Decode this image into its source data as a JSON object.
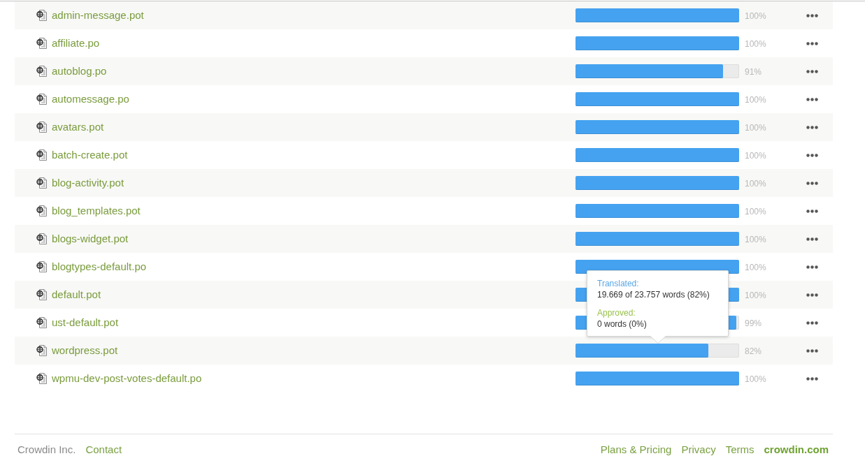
{
  "files": [
    {
      "name": "admin-message.pot",
      "level": 1,
      "percent": "100%"
    },
    {
      "name": "affiliate.po",
      "level": 1,
      "percent": "100%"
    },
    {
      "name": "autoblog.po",
      "level": 0.91,
      "percent": "91%"
    },
    {
      "name": "automessage.po",
      "level": 1,
      "percent": "100%"
    },
    {
      "name": "avatars.pot",
      "level": 1,
      "percent": "100%"
    },
    {
      "name": "batch-create.pot",
      "level": 1,
      "percent": "100%"
    },
    {
      "name": "blog-activity.pot",
      "level": 1,
      "percent": "100%"
    },
    {
      "name": "blog_templates.pot",
      "level": 1,
      "percent": "100%"
    },
    {
      "name": "blogs-widget.pot",
      "level": 1,
      "percent": "100%"
    },
    {
      "name": "blogtypes-default.po",
      "level": 1,
      "percent": "100%"
    },
    {
      "name": "default.pot",
      "level": 1,
      "percent": "100%"
    },
    {
      "name": "ust-default.pot",
      "level": 0.99,
      "percent": "99%"
    },
    {
      "name": "wordpress.pot",
      "level": 0.82,
      "percent": "82%",
      "tooltip": {
        "translated_label": "Translated:",
        "translated_value": "19.669 of 23.757 words (82%)",
        "approved_label": "Approved:",
        "approved_value": "0 words (0%)"
      }
    },
    {
      "name": "wpmu-dev-post-votes-default.po",
      "level": 1,
      "percent": "100%"
    }
  ],
  "footer": {
    "left": [
      {
        "label": "Crowdin Inc.",
        "kind": "text"
      },
      {
        "label": "Contact",
        "kind": "link"
      }
    ],
    "right": [
      {
        "label": "Plans & Pricing",
        "kind": "link"
      },
      {
        "label": "Privacy",
        "kind": "link"
      },
      {
        "label": "Terms",
        "kind": "link"
      },
      {
        "label": "crowdin.com",
        "kind": "brand"
      }
    ]
  }
}
